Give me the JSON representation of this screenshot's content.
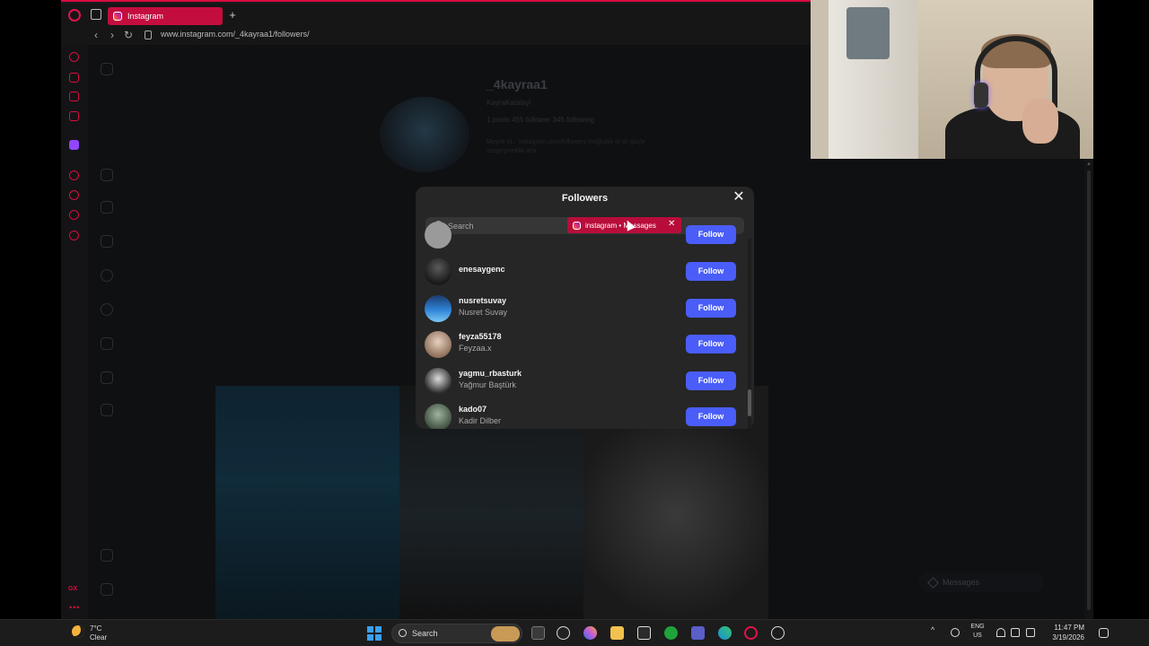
{
  "browser": {
    "tab_title": "Instagram",
    "url": "www.instagram.com/_4kayraa1/followers/"
  },
  "profile": {
    "username": "_4kayraa1",
    "fullname": "KayraKatalayi",
    "stats": "1 posts   455 follower   345 following",
    "bio": "Meyve ol...  instagram.com/followers  mağlubik ol sir güçle vazgeçmeklik arla"
  },
  "modal": {
    "title": "Followers",
    "search_placeholder": "Search",
    "follow_label": "Follow",
    "followers": [
      {
        "username": "enesaygenc",
        "fullname": ""
      },
      {
        "username": "nusretsuvay",
        "fullname": "Nusret Suvay"
      },
      {
        "username": "feyza55178",
        "fullname": "Feyzaa.x"
      },
      {
        "username": "yagmu_rbasturk",
        "fullname": "Yağmur Baştürk"
      },
      {
        "username": "kado07",
        "fullname": "Kadir Dilber"
      }
    ]
  },
  "notification_chip": {
    "label": "instagram • Messages"
  },
  "messages_pill": "Messages",
  "taskbar": {
    "temperature": "7°C",
    "condition": "Clear",
    "search_label": "Search",
    "lang": "ENG",
    "region": "US",
    "time": "11:47 PM",
    "date": "3/19/2026"
  },
  "colors": {
    "opera_red": "#d5103f",
    "follow_blue": "#4a5df9",
    "modal_bg": "#262626"
  }
}
